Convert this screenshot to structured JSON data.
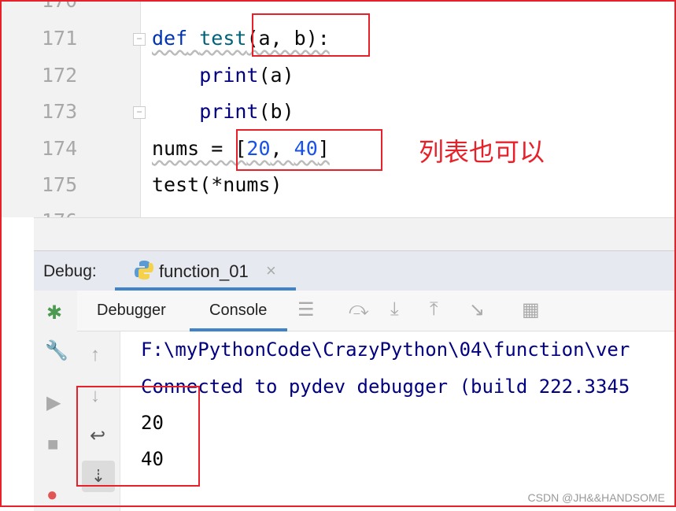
{
  "editor": {
    "line_numbers": [
      "170",
      "171",
      "172",
      "173",
      "174",
      "175",
      "176"
    ],
    "lines": {
      "l171": {
        "kw": "def",
        "fn": "test",
        "rest": "(a, b):"
      },
      "l172": {
        "indent": "    ",
        "bi": "print",
        "rest": "(a)"
      },
      "l173": {
        "indent": "    ",
        "bi": "print",
        "rest": "(b)"
      },
      "l174": {
        "pre": "nums = [",
        "n1": "20",
        "sep": ", ",
        "n2": "40",
        "post": "]"
      },
      "l175": {
        "text": "test(*nums)"
      }
    }
  },
  "annotation": {
    "note": "列表也可以",
    "color": "#e8202a"
  },
  "debug": {
    "label": "Debug:",
    "tab": "function_01",
    "close": "×",
    "subtabs": [
      "Debugger",
      "Console"
    ],
    "active_subtab": "Console"
  },
  "console": {
    "lines": [
      "F:\\myPythonCode\\CrazyPython\\04\\function\\ver",
      "Connected to pydev debugger (build 222.3345",
      "20",
      "40"
    ]
  },
  "watermark": "CSDN @JH&&HANDSOME",
  "colors": {
    "accent": "#4083c9",
    "keyword": "#0033b3",
    "number": "#1750eb"
  }
}
